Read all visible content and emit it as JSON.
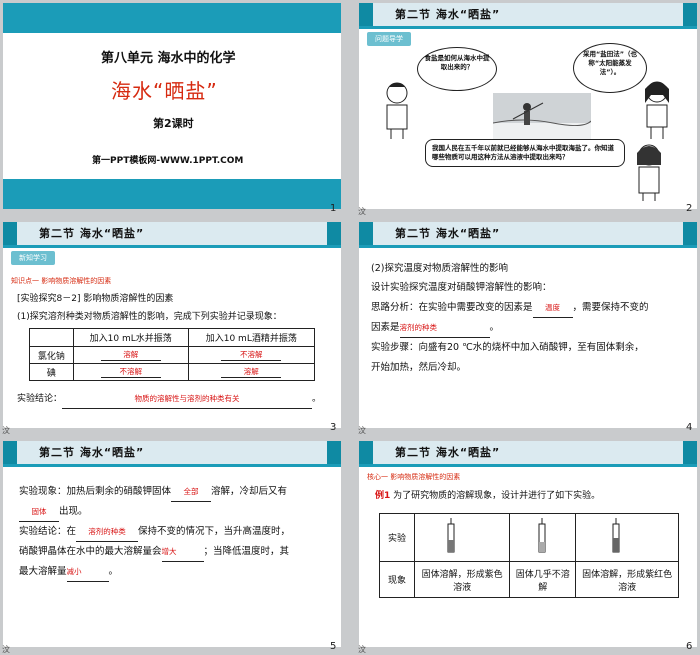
{
  "common": {
    "section": "第二节   海水“晒盐”",
    "section2": "第二节  海水“晒盐”"
  },
  "slide1": {
    "unit": "第八单元   海水中的化学",
    "title": "海水“晒盐”",
    "lesson": "第2课时",
    "source": "第一PPT模板网-WWW.1PPT.COM",
    "page": "1"
  },
  "slide2": {
    "tag": "问题导学",
    "bubble_left": "食盐是如何从海水中提取出来的？",
    "bubble_right": "采用“盐田法”（也称“太阳能蒸发法”）。",
    "bubble_bottom": "我国人民在五千年以前就已经能够从海水中提取海盐了。你知道哪些物质可以用这种方法从溶液中提取出来吗？",
    "page": "2"
  },
  "slide3": {
    "tag": "新知学习",
    "point": "知识点一   影响物质溶解性的因素",
    "exp": "[实验探究8－2]  影响物质溶解性的因素",
    "q1": "(1)探究溶剂种类对物质溶解性的影响，完成下列实验并记录现象：",
    "table": {
      "h1": "加入10 mL水并振荡",
      "h2": "加入10 mL酒精并振荡",
      "r1": "氯化钠",
      "r2": "碘",
      "a11": "溶解",
      "a12": "不溶解",
      "a21": "不溶解",
      "a22": "溶解"
    },
    "concl_label": "实验结论：",
    "concl": "物质的溶解性与溶剂的种类有关",
    "page": "3"
  },
  "slide4": {
    "l1": "(2)探究温度对物质溶解性的影响",
    "l2": "设计实验探究温度对硝酸钾溶解性的影响：",
    "l3a": "思路分析：在实验中需要改变的因素是",
    "b1": "温度",
    "l3b": "，需要保持不变的",
    "l4a": "因素是",
    "b2": "溶剂的种类",
    "l4b": "。",
    "l5": "实验步骤：向盛有20 ℃水的烧杯中加入硝酸钾，至有固体剩余，",
    "l6": "开始加热，然后冷却。",
    "page": "4"
  },
  "slide5": {
    "l1a": "实验现象：加热后剩余的硝酸钾固体",
    "b1": "全部",
    "l1b": "溶解，冷却后又有",
    "b2": "固体",
    "l2b": "出现。",
    "l3a": "实验结论：在",
    "b3": "溶剂的种类",
    "l3b": "保持不变的情况下，当升高温度时，",
    "l4a": "硝酸钾晶体在水中的最大溶解量会",
    "b4": "增大",
    "l4b": "；当降低温度时，其",
    "l5a": "最大溶解量",
    "b5": "减小",
    "l5b": "。",
    "page": "5"
  },
  "slide6": {
    "point": "核心一   影响物质溶解性的因素",
    "ex": "例1",
    "extext": "为了研究物质的溶解现象，设计并进行了如下实验。",
    "row1": "实验",
    "row2": "现象",
    "p1": "固体溶解，形成紫色溶液",
    "p2": "固体几乎不溶解",
    "p3": "固体溶解，形成紫红色溶液",
    "page": "6"
  },
  "watermark": "汶"
}
